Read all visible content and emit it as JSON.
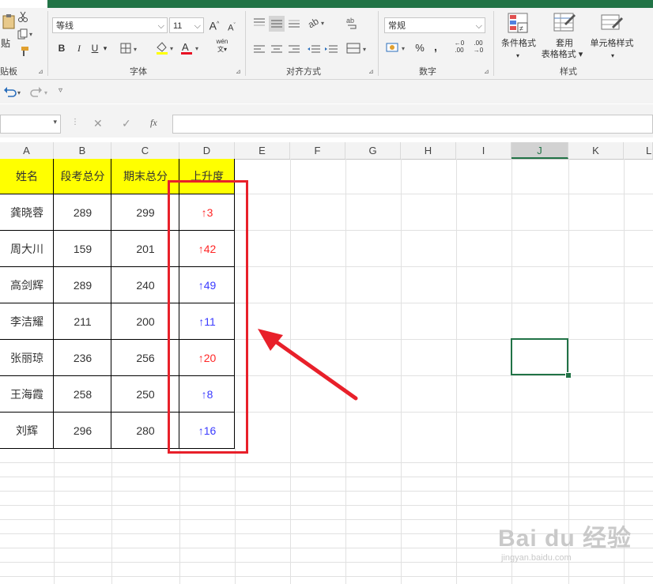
{
  "ribbon": {
    "clipboard": {
      "paste_label": "贴",
      "group_label": "贴板"
    },
    "font": {
      "font_name": "等线",
      "font_size": "11",
      "grow_label": "A",
      "shrink_label": "A",
      "bold": "B",
      "italic": "I",
      "underline": "U",
      "phonetic": "wén",
      "group_label": "字体",
      "font_color": "#e81123"
    },
    "alignment": {
      "group_label": "对齐方式"
    },
    "number": {
      "format": "常规",
      "percent": "%",
      "comma": ",",
      "inc_dec": "←0 .00",
      "dec_dec": ".00 →0",
      "group_label": "数字"
    },
    "styles": {
      "conditional_label": "条件格式",
      "table_label_1": "套用",
      "table_label_2": "表格格式",
      "cell_styles_label": "单元格样式",
      "group_label": "样式"
    }
  },
  "formula_bar": {
    "fx_label": "fx",
    "cancel": "✕",
    "enter": "✓"
  },
  "columns": [
    "A",
    "B",
    "C",
    "D",
    "E",
    "F",
    "G",
    "H",
    "I",
    "J",
    "K",
    "L"
  ],
  "selected_column": "J",
  "table": {
    "headers": [
      "姓名",
      "段考总分",
      "期末总分",
      "上升度"
    ],
    "header_bg": "#ffff00",
    "rows": [
      {
        "name": "龚晓蓉",
        "midterm": "289",
        "final": "299",
        "rise": "3",
        "color": "red"
      },
      {
        "name": "周大川",
        "midterm": "159",
        "final": "201",
        "rise": "42",
        "color": "red"
      },
      {
        "name": "高剑辉",
        "midterm": "289",
        "final": "240",
        "rise": "49",
        "color": "blue"
      },
      {
        "name": "李洁耀",
        "midterm": "211",
        "final": "200",
        "rise": "11",
        "color": "blue"
      },
      {
        "name": "张丽琼",
        "midterm": "236",
        "final": "256",
        "rise": "20",
        "color": "red"
      },
      {
        "name": "王海霞",
        "midterm": "258",
        "final": "250",
        "rise": "8",
        "color": "blue"
      },
      {
        "name": "刘辉",
        "midterm": "296",
        "final": "280",
        "rise": "16",
        "color": "blue"
      }
    ],
    "arrow_glyph": "↑"
  },
  "annotation": {
    "box_color": "#e8202a",
    "arrow_color": "#e8202a"
  },
  "watermark": {
    "main": "Bai du 经验",
    "sub": "jingyan.baidu.com"
  }
}
